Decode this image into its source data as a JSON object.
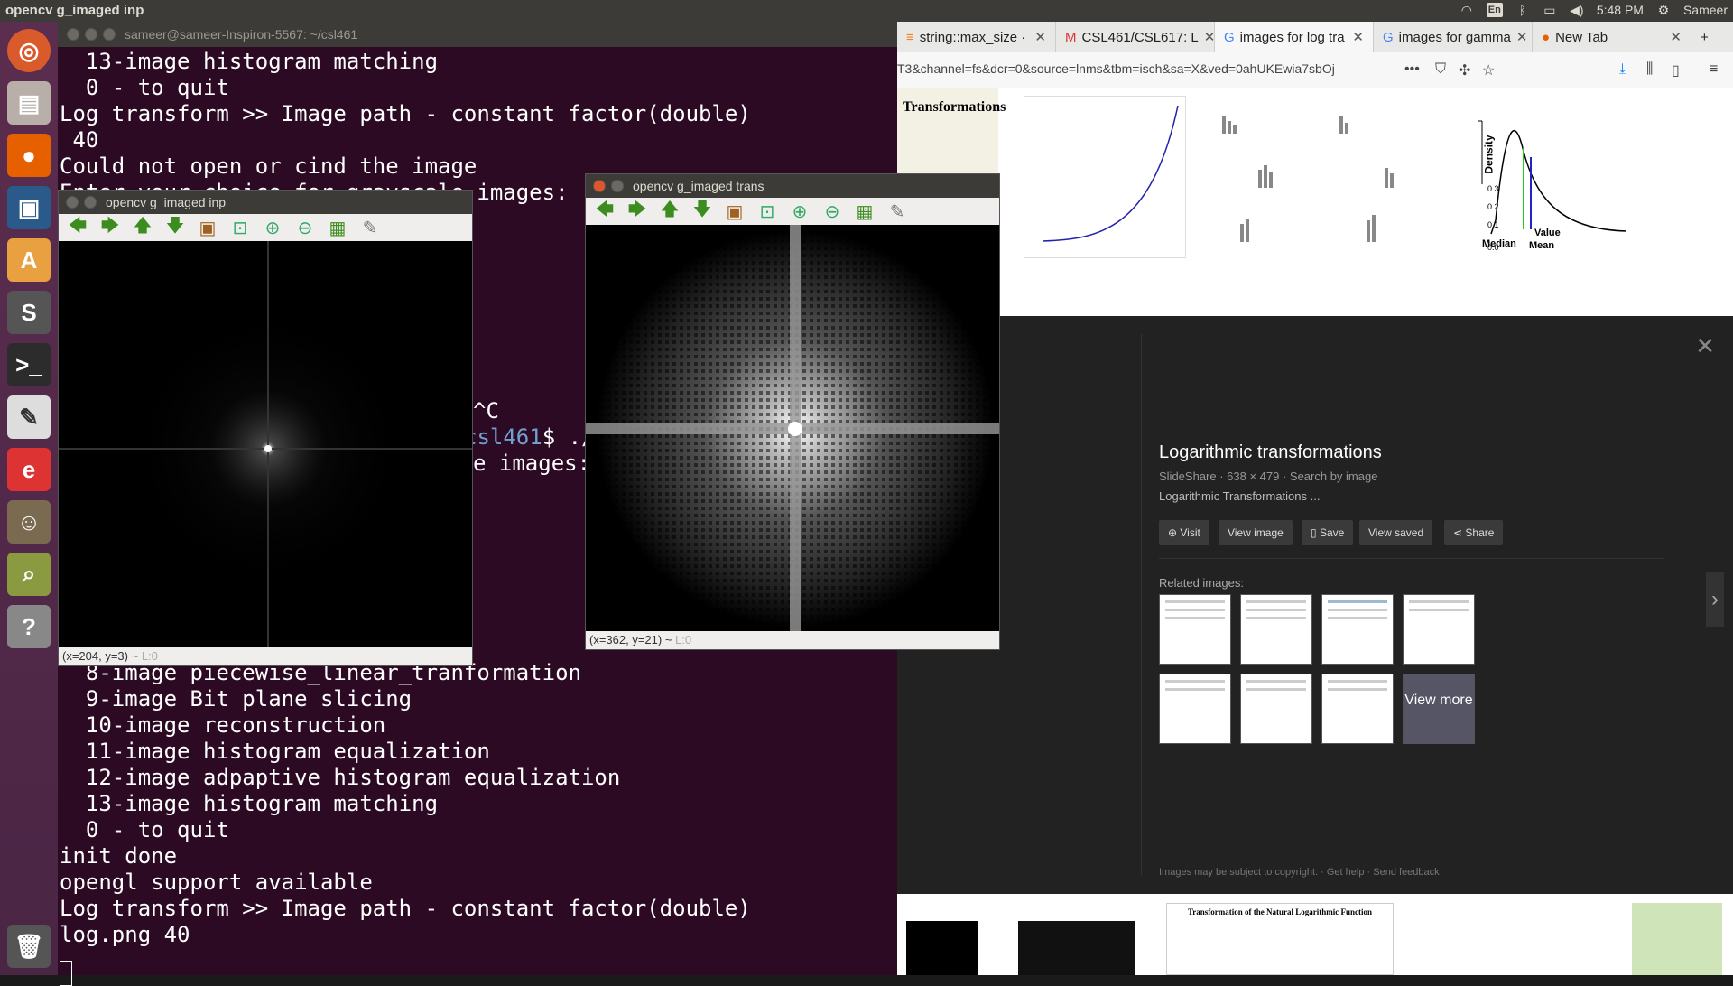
{
  "topbar": {
    "title": "opencv g_imaged inp",
    "lang": "En",
    "time": "5:48 PM",
    "user": "Sameer"
  },
  "launcher": {
    "items": [
      "ubuntu-dash-icon",
      "files-icon",
      "firefox-icon",
      "workspace-icon",
      "software-center-icon",
      "sublime-icon",
      "terminal-icon",
      "text-editor-icon",
      "document-viewer-icon",
      "gimp-icon",
      "image-viewer-icon",
      "help-icon",
      "trash-icon"
    ]
  },
  "terminal": {
    "title": "sameer@sameer-Inspiron-5567: ~/csl461",
    "lines_top": [
      "  13-image histogram matching",
      "  0 - to quit",
      "Log transform >> Image path - constant factor(double)",
      " 40",
      "Could not open or cind the image",
      "Enter your choice for grayscale images:"
    ],
    "partial_cc": "^C",
    "prompt_host_tail": "csl461",
    "prompt_tail": "$ ./",
    "partial_images": "e images:",
    "lines_bottom": [
      "  8-image piecewise_linear_tranformation",
      "  9-image Bit plane slicing",
      "  10-image reconstruction",
      "  11-image histogram equalization",
      "  12-image adpaptive histogram equalization",
      "  13-image histogram matching",
      "  0 - to quit",
      "init done",
      "opengl support available",
      "Log transform >> Image path - constant factor(double)",
      "log.png 40"
    ]
  },
  "cv_inp": {
    "title": "opencv g_imaged inp",
    "status": "(x=204, y=3) ~",
    "status_l": "L:0"
  },
  "cv_trans": {
    "title": "opencv g_imaged trans",
    "status": "(x=362, y=21) ~",
    "status_l": "L:0"
  },
  "browser": {
    "tabs": [
      {
        "label": "string::max_size ·",
        "icon": "stackoverflow-icon"
      },
      {
        "label": "CSL461/CSL617: L",
        "icon": "gmail-icon"
      },
      {
        "label": "images for log tra",
        "icon": "google-icon",
        "active": true
      },
      {
        "label": "images for gamma",
        "icon": "google-icon"
      },
      {
        "label": "New Tab",
        "icon": "firefox-icon"
      }
    ],
    "url": "T3&channel=fs&dcr=0&source=lnms&tbm=isch&sa=X&ved=0ahUKEwia7sbOj",
    "top_thumb_title": "Transformations",
    "panel": {
      "title": "Logarithmic transformations",
      "meta": "SlideShare · 638 × 479 · Search by image",
      "desc": "Logarithmic Transformations ...",
      "buttons": [
        "Visit",
        "View image",
        "Save",
        "View saved",
        "Share"
      ],
      "related": "Related images:",
      "view_more": "View more",
      "copyright": "Images may be subject to copyright.",
      "help": "Get help",
      "feedback": "Send feedback"
    },
    "density_chart": {
      "ylabel": "Density",
      "labels": [
        "Median",
        "Value",
        "Mean"
      ],
      "yticks": [
        "0.0",
        "0.1",
        "0.2",
        "0.3"
      ]
    },
    "bottom_thumb_title": "Transformation of the Natural Logarithmic Function"
  }
}
